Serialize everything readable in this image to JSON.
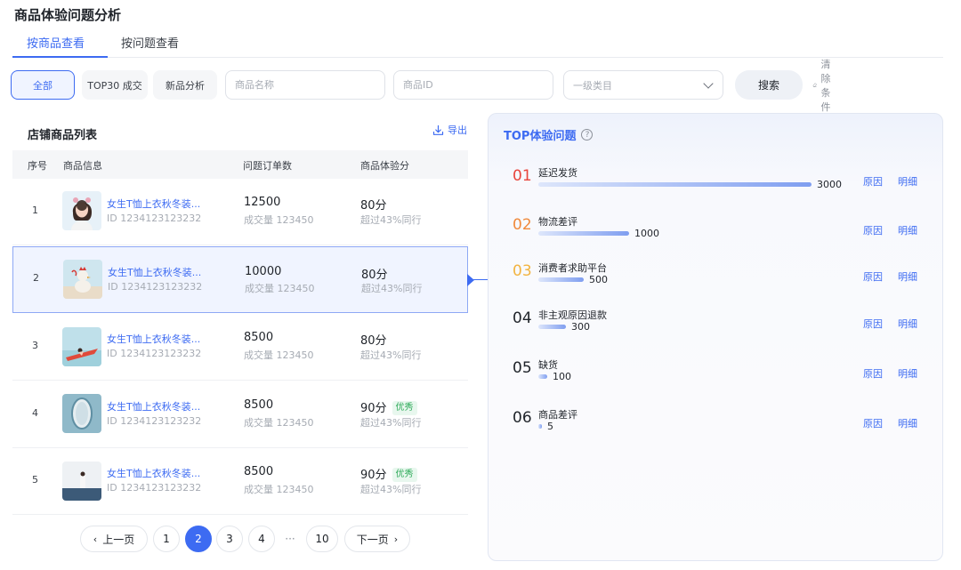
{
  "page": {
    "title": "商品体验问题分析"
  },
  "tabs": [
    {
      "label": "按商品查看",
      "active": true
    },
    {
      "label": "按问题查看",
      "active": false
    }
  ],
  "filters": {
    "chips": [
      "全部",
      "TOP30 成交",
      "新品分析"
    ],
    "name_placeholder": "商品名称",
    "id_placeholder": "商品ID",
    "category_value": "一级类目",
    "search_label": "搜索",
    "clear_label": "清除条件"
  },
  "list": {
    "title": "店铺商品列表",
    "export_label": "导出",
    "columns": [
      "序号",
      "商品信息",
      "问题订单数",
      "商品体验分"
    ],
    "rows": [
      {
        "no": "1",
        "name": "女生T恤上衣秋冬装...",
        "id": "ID 1234123123232",
        "orders": "12500",
        "deals": "成交量 123450",
        "score": "80分",
        "badge": "",
        "beat": "超过43%同行"
      },
      {
        "no": "2",
        "name": "女生T恤上衣秋冬装...",
        "id": "ID 1234123123232",
        "orders": "10000",
        "deals": "成交量 123450",
        "score": "80分",
        "badge": "",
        "beat": "超过43%同行"
      },
      {
        "no": "3",
        "name": "女生T恤上衣秋冬装...",
        "id": "ID 1234123123232",
        "orders": "8500",
        "deals": "成交量 123450",
        "score": "80分",
        "badge": "",
        "beat": "超过43%同行"
      },
      {
        "no": "4",
        "name": "女生T恤上衣秋冬装...",
        "id": "ID 1234123123232",
        "orders": "8500",
        "deals": "成交量 123450",
        "score": "90分",
        "badge": "优秀",
        "beat": "超过43%同行"
      },
      {
        "no": "5",
        "name": "女生T恤上衣秋冬装...",
        "id": "ID 1234123123232",
        "orders": "8500",
        "deals": "成交量 123450",
        "score": "90分",
        "badge": "优秀",
        "beat": "超过43%同行"
      }
    ],
    "selected_row": "2"
  },
  "pagination": {
    "prev_label": "上一页",
    "next_label": "下一页",
    "pages": [
      "1",
      "2",
      "3",
      "4",
      "···",
      "10"
    ],
    "current": "2"
  },
  "top_issues": {
    "title": "TOP体验问题",
    "reason_label": "原因",
    "detail_label": "明细",
    "items": [
      {
        "rank": "01",
        "name": "延迟发货",
        "count": 3000,
        "color": "#e8453c"
      },
      {
        "rank": "02",
        "name": "物流差评",
        "count": 1000,
        "color": "#f08a3c"
      },
      {
        "rank": "03",
        "name": "消费者求助平台",
        "count": 500,
        "color": "#f2b441"
      },
      {
        "rank": "04",
        "name": "非主观原因退款",
        "count": 300,
        "color": "#1f2329"
      },
      {
        "rank": "05",
        "name": "缺货",
        "count": 100,
        "color": "#1f2329"
      },
      {
        "rank": "06",
        "name": "商品差评",
        "count": 5,
        "color": "#1f2329"
      }
    ]
  },
  "colors": {
    "accent": "#3d6bf2",
    "badge_green": "#2fab5a"
  }
}
